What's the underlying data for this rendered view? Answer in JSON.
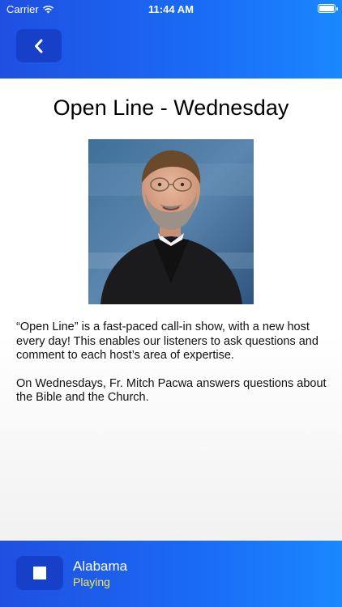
{
  "status_bar": {
    "carrier": "Carrier",
    "time": "11:44 AM"
  },
  "header": {
    "back_icon": "chevron-left-icon"
  },
  "page": {
    "title": "Open Line - Wednesday",
    "image_alt": "host-portrait",
    "paragraphs": [
      "“Open Line” is a fast-paced call-in show, with a new host every day! This enables our listeners to ask questions and comment to each host’s area of expertise.",
      "On Wednesdays, Fr. Mitch Pacwa answers questions about the Bible and the Church."
    ]
  },
  "player": {
    "station": "Alabama",
    "state": "Playing",
    "stop_icon": "stop-icon"
  },
  "colors": {
    "header_gradient_start": "#1f4fe0",
    "header_gradient_end": "#1a88ff",
    "button_bg": "#1640c8",
    "state_text": "#f6e84a"
  }
}
